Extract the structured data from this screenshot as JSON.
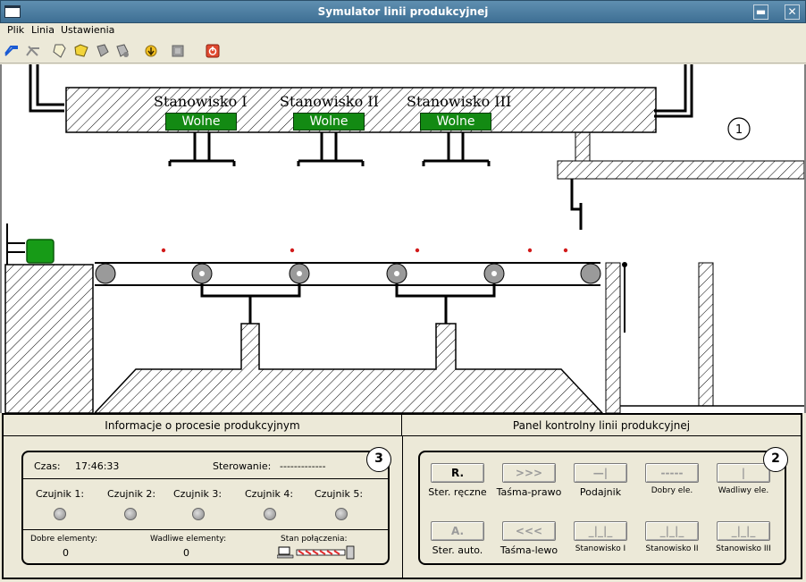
{
  "window": {
    "title": "Symulator linii produkcyjnej",
    "minimize_label": "▬",
    "close_label": "✕"
  },
  "menu": {
    "items": [
      "Plik",
      "Linia",
      "Ustawienia"
    ]
  },
  "toolbar": {
    "icons": [
      "connect-icon",
      "disconnect-icon",
      "new-icon",
      "open-icon",
      "save-icon",
      "save-as-icon",
      "refresh-icon",
      "stop-icon",
      "power-icon"
    ]
  },
  "scene": {
    "stations": [
      {
        "name": "Stanowisko I",
        "status": "Wolne"
      },
      {
        "name": "Stanowisko II",
        "status": "Wolne"
      },
      {
        "name": "Stanowisko III",
        "status": "Wolne"
      }
    ],
    "marker_1": "1",
    "status_color": "#138a13"
  },
  "info_panel": {
    "header": "Informacje o procesie produkcyjnym",
    "marker": "3",
    "time_label": "Czas:",
    "time_value": "17:46:33",
    "control_label": "Sterowanie:",
    "control_value": "-------------",
    "sensors": [
      "Czujnik 1:",
      "Czujnik 2:",
      "Czujnik 3:",
      "Czujnik 4:",
      "Czujnik 5:"
    ],
    "good_label": "Dobre elementy:",
    "good_value": "0",
    "bad_label": "Wadliwe elementy:",
    "bad_value": "0",
    "connection_label": "Stan połączenia:"
  },
  "control_panel": {
    "header": "Panel kontrolny linii produkcyjnej",
    "marker": "2",
    "row1": [
      {
        "btn": "R.",
        "label": "Ster. ręczne"
      },
      {
        "btn": ">>>",
        "label": "Taśma-prawo"
      },
      {
        "btn": "—|",
        "label": "Podajnik"
      },
      {
        "btn": "-----",
        "label": "Dobry ele."
      },
      {
        "btn": "|",
        "label": "Wadliwy ele."
      }
    ],
    "row2": [
      {
        "btn": "A.",
        "label": "Ster. auto."
      },
      {
        "btn": "<<<",
        "label": "Taśma-lewo"
      },
      {
        "btn": "_|_|_",
        "label": "Stanowisko I"
      },
      {
        "btn": "_|_|_",
        "label": "Stanowisko II"
      },
      {
        "btn": "_|_|_",
        "label": "Stanowisko III"
      }
    ]
  }
}
